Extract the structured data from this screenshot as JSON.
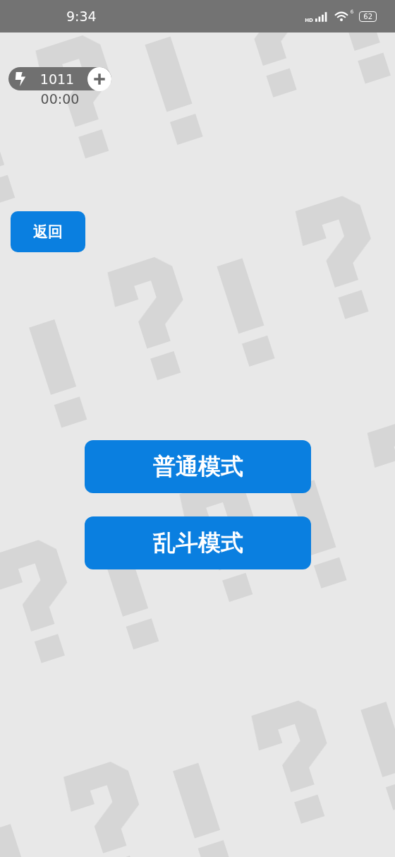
{
  "status_bar": {
    "time": "9:34",
    "network_label": "HD",
    "wifi_label": "6",
    "battery": "62"
  },
  "energy": {
    "count": "1011",
    "timer": "00:00"
  },
  "back_button": {
    "label": "返回"
  },
  "mode_buttons": [
    {
      "label": "普通模式"
    },
    {
      "label": "乱斗模式"
    }
  ]
}
